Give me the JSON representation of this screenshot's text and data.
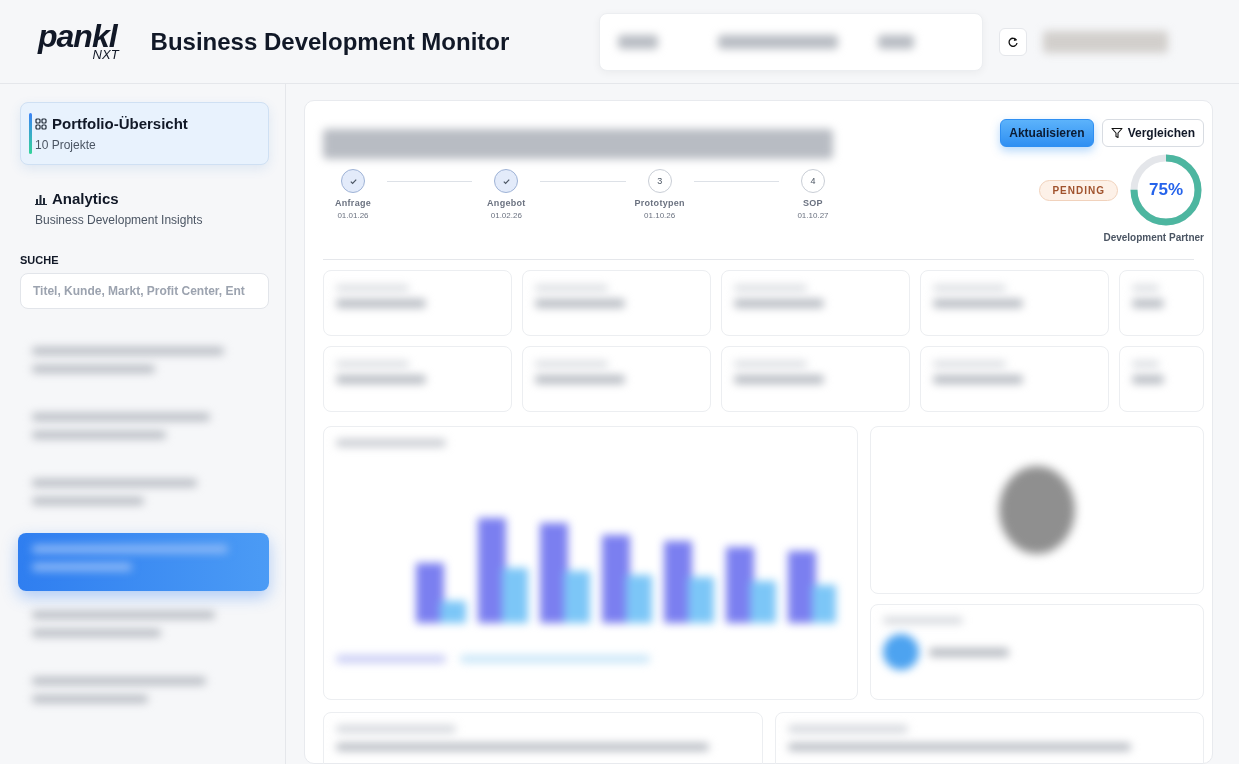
{
  "header": {
    "logo": {
      "wordmark": "pankl",
      "suffix": "NXT"
    },
    "title": "Business Development Monitor"
  },
  "sidebar": {
    "nav": [
      {
        "title": "Portfolio-Übersicht",
        "subtitle": "10 Projekte",
        "selected": true
      },
      {
        "title": "Analytics",
        "subtitle": "Business Development Insights",
        "selected": false
      }
    ],
    "search": {
      "label": "SUCHE",
      "placeholder": "Titel, Kunde, Markt, Profit Center, Ent"
    },
    "projects": [
      {
        "selected": false
      },
      {
        "selected": false
      },
      {
        "selected": false
      },
      {
        "selected": true
      },
      {
        "selected": false
      },
      {
        "selected": false
      }
    ]
  },
  "project": {
    "buttons": [
      {
        "label": "Aktualisieren",
        "kind": "primary"
      },
      {
        "label": "Vergleichen",
        "kind": "filter"
      }
    ],
    "steps": [
      {
        "label": "Anfrage",
        "date": "01.01.26",
        "done": true
      },
      {
        "label": "Angebot",
        "date": "01.02.26",
        "done": true
      },
      {
        "number": "3",
        "label": "Prototypen",
        "date": "01.10.26",
        "done": false
      },
      {
        "number": "4",
        "label": "SOP",
        "date": "01.10.27",
        "done": false
      }
    ],
    "status": "PENDING",
    "progress": {
      "level": 0.75,
      "reading": "75%",
      "caption": "Development Partner"
    }
  }
}
